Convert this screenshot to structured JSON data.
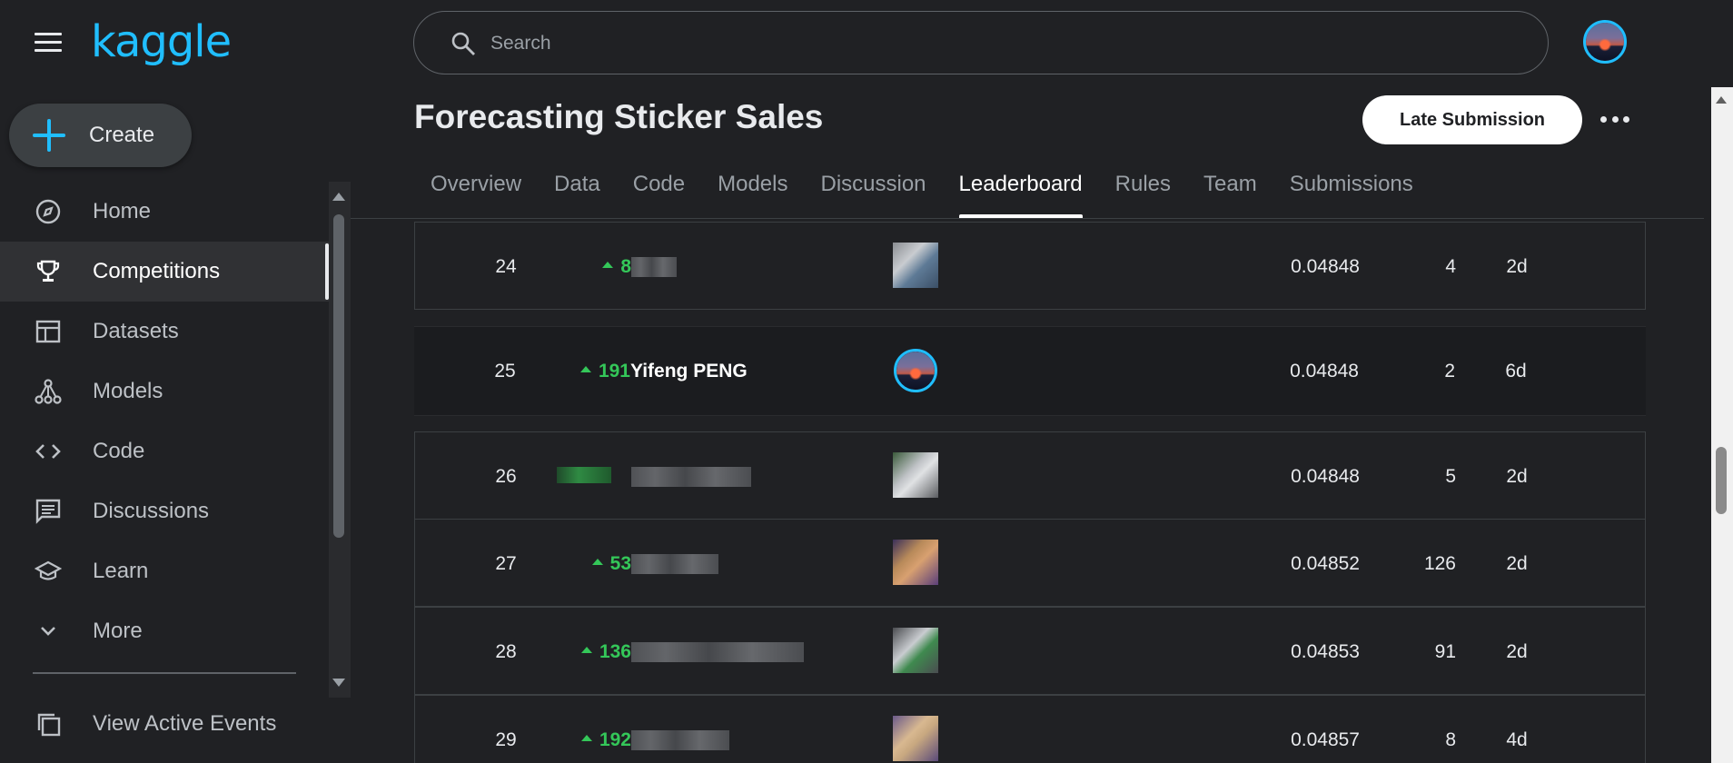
{
  "brand": {
    "logo_text": "kaggle",
    "accent": "#20beff"
  },
  "sidebar": {
    "create_label": "Create",
    "items": [
      {
        "label": "Home",
        "icon": "compass-icon",
        "active": false
      },
      {
        "label": "Competitions",
        "icon": "trophy-icon",
        "active": true
      },
      {
        "label": "Datasets",
        "icon": "table-icon",
        "active": false
      },
      {
        "label": "Models",
        "icon": "models-icon",
        "active": false
      },
      {
        "label": "Code",
        "icon": "code-icon",
        "active": false
      },
      {
        "label": "Discussions",
        "icon": "discussion-icon",
        "active": false
      },
      {
        "label": "Learn",
        "icon": "graduation-cap-icon",
        "active": false
      },
      {
        "label": "More",
        "icon": "chevron-down-icon",
        "active": false
      }
    ],
    "events_label": "View Active Events"
  },
  "search": {
    "placeholder": "Search"
  },
  "competition": {
    "title": "Forecasting Sticker Sales",
    "late_submission_label": "Late Submission"
  },
  "tabs": [
    {
      "label": "Overview",
      "active": false
    },
    {
      "label": "Data",
      "active": false
    },
    {
      "label": "Code",
      "active": false
    },
    {
      "label": "Models",
      "active": false
    },
    {
      "label": "Discussion",
      "active": false
    },
    {
      "label": "Leaderboard",
      "active": true
    },
    {
      "label": "Rules",
      "active": false
    },
    {
      "label": "Team",
      "active": false
    },
    {
      "label": "Submissions",
      "active": false
    }
  ],
  "leaderboard": {
    "rows": [
      {
        "rank": "24",
        "delta": "8",
        "name": "",
        "score": "0.04848",
        "entries": "4",
        "last": "2d",
        "is_me": false
      },
      {
        "rank": "25",
        "delta": "191",
        "name": "Yifeng PENG",
        "score": "0.04848",
        "entries": "2",
        "last": "6d",
        "is_me": true
      },
      {
        "rank": "26",
        "delta": "",
        "name": "",
        "score": "0.04848",
        "entries": "5",
        "last": "2d",
        "is_me": false
      },
      {
        "rank": "27",
        "delta": "53",
        "name": "",
        "score": "0.04852",
        "entries": "126",
        "last": "2d",
        "is_me": false
      },
      {
        "rank": "28",
        "delta": "136",
        "name": "",
        "score": "0.04853",
        "entries": "91",
        "last": "2d",
        "is_me": false
      },
      {
        "rank": "29",
        "delta": "192",
        "name": "",
        "score": "0.04857",
        "entries": "8",
        "last": "4d",
        "is_me": false
      }
    ]
  }
}
